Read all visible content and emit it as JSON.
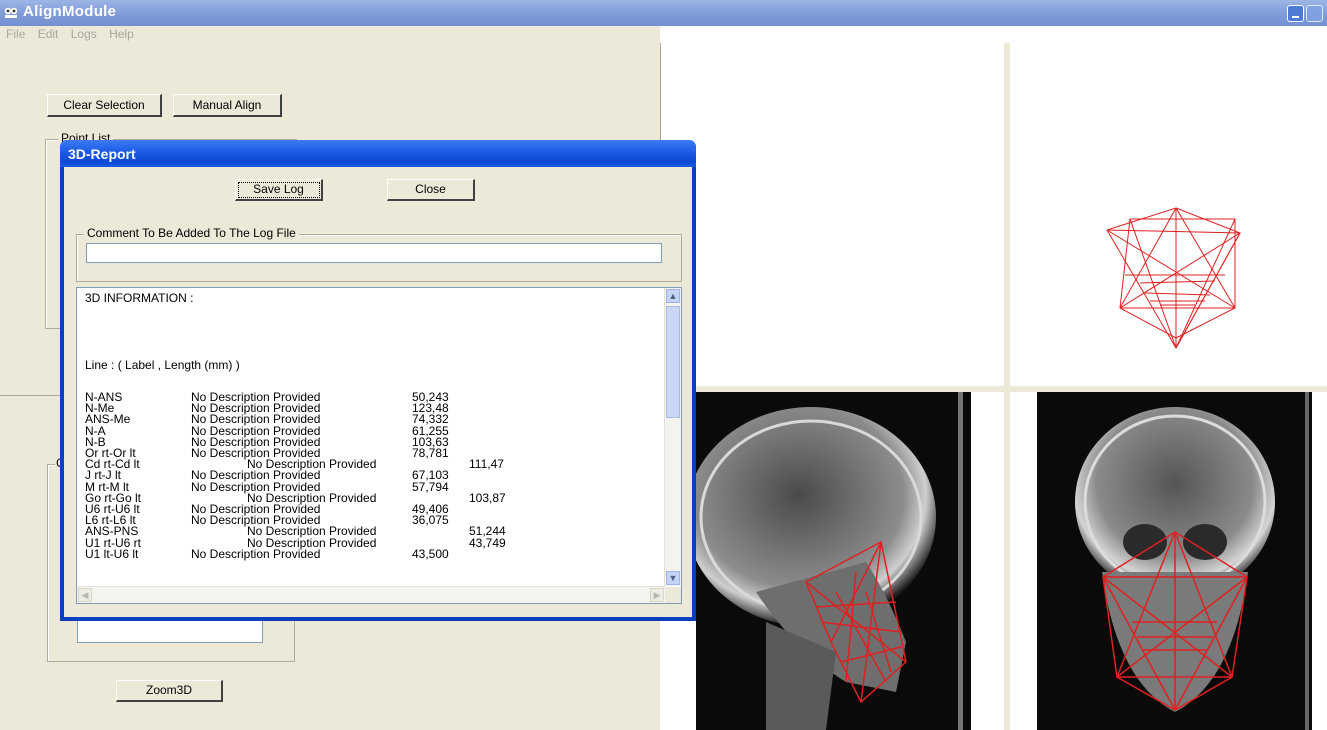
{
  "window": {
    "title": "AlignModule"
  },
  "menu": [
    "File",
    "Edit",
    "Logs",
    "Help"
  ],
  "left_panel": {
    "clear_selection_label": "Clear Selection",
    "manual_align_label": "Manual Align",
    "point_list_label": "Point List",
    "lower_group_label": "G",
    "zoom3d_label": "Zoom3D"
  },
  "dialog": {
    "title": "3D-Report",
    "save_log_label": "Save Log",
    "close_label": "Close",
    "comment_group_label": "Comment To Be Added To The Log File",
    "comment_value": "",
    "info_heading": "3D INFORMATION :",
    "line_header": "Line : ( Label , Length (mm) )",
    "rows": [
      {
        "label": "N-ANS",
        "desc": "No Description Provided",
        "length": "50,243",
        "indent": false
      },
      {
        "label": "N-Me",
        "desc": "No Description Provided",
        "length": "123,48",
        "indent": false
      },
      {
        "label": "ANS-Me",
        "desc": "No Description Provided",
        "length": "74,332",
        "indent": false
      },
      {
        "label": "N-A",
        "desc": "No Description Provided",
        "length": "61,255",
        "indent": false
      },
      {
        "label": "N-B",
        "desc": "No Description Provided",
        "length": "103,63",
        "indent": false
      },
      {
        "label": "Or rt-Or lt",
        "desc": "No Description Provided",
        "length": "78,781",
        "indent": false
      },
      {
        "label": "Cd rt-Cd lt",
        "desc": "No Description Provided",
        "length": "111,47",
        "indent": true
      },
      {
        "label": "J rt-J lt",
        "desc": "No Description Provided",
        "length": "67,103",
        "indent": false
      },
      {
        "label": "M rt-M lt",
        "desc": "No Description Provided",
        "length": "57,794",
        "indent": false
      },
      {
        "label": "Go rt-Go lt",
        "desc": "No Description Provided",
        "length": "103,87",
        "indent": true
      },
      {
        "label": "U6 rt-U6 lt",
        "desc": "No Description Provided",
        "length": "49,406",
        "indent": false
      },
      {
        "label": "L6 rt-L6 lt",
        "desc": "No Description Provided",
        "length": "36,075",
        "indent": false
      },
      {
        "label": "ANS-PNS",
        "desc": "No Description Provided",
        "length": "51,244",
        "indent": true
      },
      {
        "label": "U1 rt-U6 rt",
        "desc": "No Description Provided",
        "length": "43,749",
        "indent": true
      },
      {
        "label": "U1 lt-U6 lt",
        "desc": "No Description Provided",
        "length": "43,500",
        "indent": false
      }
    ]
  },
  "views": {
    "top_left": "blank 3D view",
    "top_right": "3D landmark wireframe",
    "bottom_left": "lateral cephalogram with red landmark lines",
    "bottom_right": "frontal cephalogram with red landmark lines"
  },
  "colors": {
    "landmark_lines": "#e02020",
    "title_bar": "#0c49d4",
    "window_bg": "#ece9d8"
  }
}
